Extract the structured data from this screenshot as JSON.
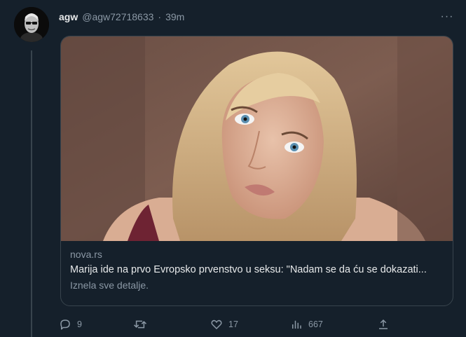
{
  "tweet": {
    "display_name": "agw",
    "handle": "@agw72718633",
    "separator": "·",
    "time": "39m",
    "more": "···"
  },
  "card": {
    "domain": "nova.rs",
    "title": "Marija ide na prvo Evropsko prvenstvo u seksu: \"Nadam se da ću se dokazati...",
    "description": "Iznela sve detalje."
  },
  "actions": {
    "reply_count": "9",
    "retweet_count": "",
    "like_count": "17",
    "views_count": "667"
  },
  "icons": {
    "reply": "reply-icon",
    "retweet": "retweet-icon",
    "like": "heart-icon",
    "views": "views-icon",
    "share": "share-icon",
    "more": "more-icon"
  },
  "colors": {
    "background": "#15202b",
    "border": "#38444d",
    "primary_text": "#e7e9ea",
    "secondary_text": "#8b98a5"
  }
}
